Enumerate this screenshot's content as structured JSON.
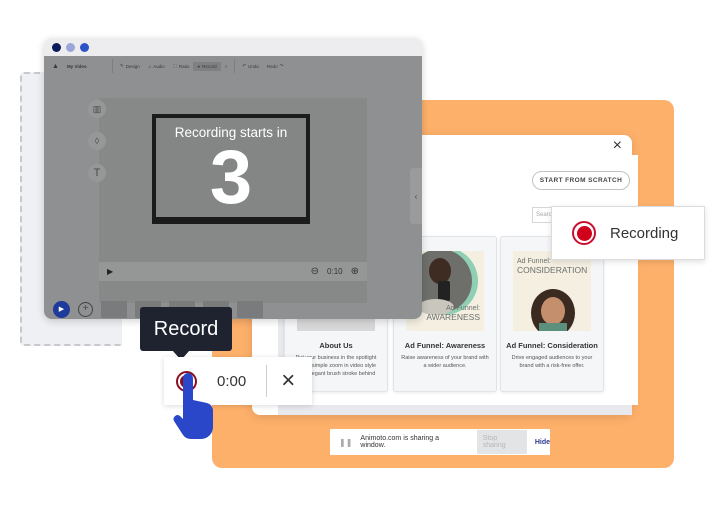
{
  "colors": {
    "orange_backdrop": "#fdb06a",
    "record_red": "#d0021b",
    "tooltip_bg": "#1f2330",
    "hand_blue": "#2a47c9",
    "dot_colors": [
      "#0d1a5c",
      "#9aa6d8",
      "#2e55c8"
    ]
  },
  "editor": {
    "project_name": "My Video",
    "toolbar": {
      "design": "Design",
      "audio": "Audio",
      "ratio": "Ratio",
      "record": "Record",
      "undo": "Undo",
      "redo": "Redo"
    },
    "countdown_label": "Recording starts in",
    "countdown_value": "3",
    "scene_duration": "0:10",
    "icons": {
      "logo": "animoto-logo-icon",
      "layout": "layout-icon",
      "color": "droplet-icon",
      "text": "text-icon",
      "play": "play-icon",
      "minus": "minus-circle-icon",
      "plus": "plus-circle-icon",
      "collapse": "chevron-left-icon",
      "add_scene": "plus-circle-icon",
      "search": "search-icon"
    }
  },
  "templates": {
    "close_icon": "×",
    "start_from_scratch": "START FROM SCRATCH",
    "search_placeholder": "Search all tem",
    "cards": [
      {
        "title": "About Us",
        "description": "Put your business in the spotlight with a simple zoom in video style and elegant brush stroke behind"
      },
      {
        "title": "Ad Funnel: Awareness",
        "description": "Raise awareness of your brand with a wider audience.",
        "thumb_line1": "Ad Funnel:",
        "thumb_line2": "AWARENESS"
      },
      {
        "title": "Ad Funnel: Consideration",
        "description": "Drive engaged audiences to your brand with a risk-free offer.",
        "thumb_line1": "Ad Funnel:",
        "thumb_line2": "CONSIDERATION"
      }
    ]
  },
  "recording_indicator": {
    "label": "Recording"
  },
  "record_control": {
    "tooltip": "Record",
    "timer": "0:00",
    "close_icon": "×"
  },
  "share_bar": {
    "message": "Animoto.com is sharing a window.",
    "stop_label": "Stop sharing",
    "hide_label": "Hide"
  }
}
